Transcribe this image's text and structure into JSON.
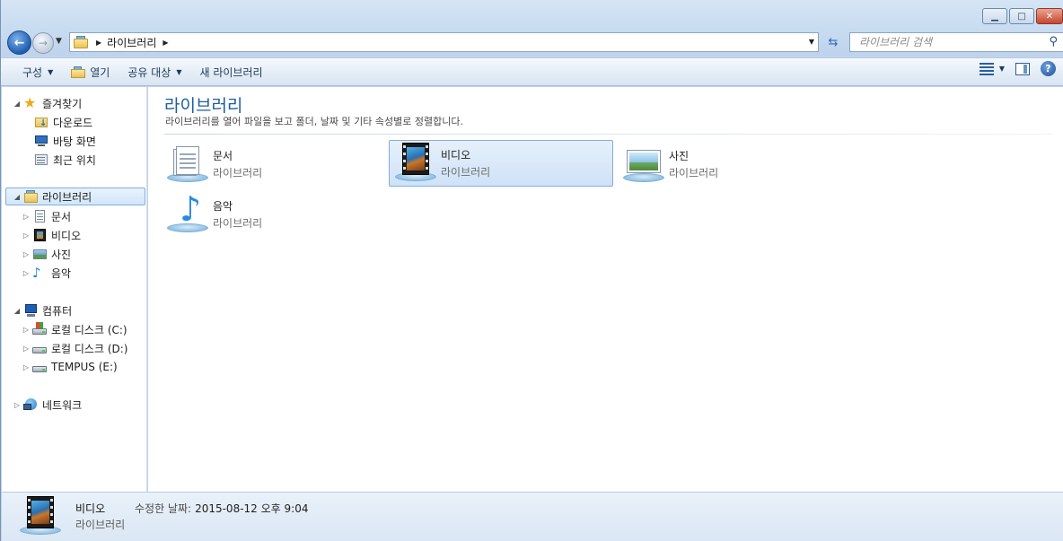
{
  "window": {
    "controls": {
      "minimize": "▁",
      "maximize": "□",
      "close": "✕"
    }
  },
  "nav": {
    "back": "←",
    "forward": "→",
    "breadcrumb": [
      "라이브러리"
    ],
    "search_placeholder": "라이브러리 검색"
  },
  "toolbar": {
    "organize": "구성",
    "open": "열기",
    "share": "공유 대상",
    "new_library": "새 라이브러리",
    "help": "?"
  },
  "sidebar": {
    "favorites": {
      "label": "즐겨찾기",
      "items": [
        "다운로드",
        "바탕 화면",
        "최근 위치"
      ]
    },
    "libraries": {
      "label": "라이브러리",
      "items": [
        "문서",
        "비디오",
        "사진",
        "음악"
      ]
    },
    "computer": {
      "label": "컴퓨터",
      "items": [
        "로컬 디스크 (C:)",
        "로컬 디스크 (D:)",
        "TEMPUS (E:)"
      ]
    },
    "network": {
      "label": "네트워크"
    }
  },
  "content": {
    "title": "라이브러리",
    "description": "라이브러리를 열어 파일을 보고 폴더, 날짜 및 기타 속성별로 정렬합니다.",
    "tiles": [
      {
        "name": "문서",
        "type": "라이브러리"
      },
      {
        "name": "비디오",
        "type": "라이브러리"
      },
      {
        "name": "사진",
        "type": "라이브러리"
      },
      {
        "name": "음악",
        "type": "라이브러리"
      }
    ],
    "selected_tile": "비디오"
  },
  "details": {
    "name": "비디오",
    "type": "라이브러리",
    "modified_label": "수정한 날짜:",
    "modified_value": "2015-08-12 오후 9:04"
  },
  "colors": {
    "title_accent": "#1e5d9e",
    "selection_border": "#84acdd"
  }
}
